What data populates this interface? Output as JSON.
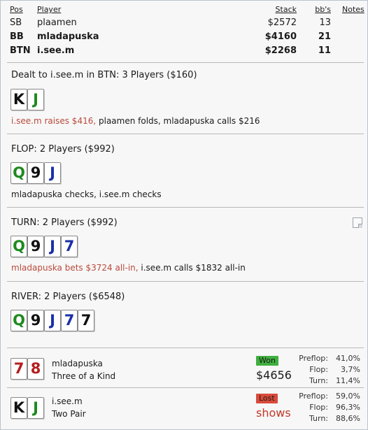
{
  "players_header": {
    "pos": "Pos",
    "player": "Player",
    "stack": "Stack",
    "bbs": "bb's",
    "notes": "Notes"
  },
  "players": [
    {
      "pos": "SB",
      "name": "plaamen",
      "stack": "$2572",
      "bbs": "13"
    },
    {
      "pos": "BB",
      "name": "mladapuska",
      "stack": "$4160",
      "bbs": "21"
    },
    {
      "pos": "BTN",
      "name": "i.see.m",
      "stack": "$2268",
      "bbs": "11"
    }
  ],
  "preflop": {
    "title": "Dealt to i.see.m in BTN: 3 Players ($160)",
    "cards": [
      {
        "rank": "K",
        "suit": "spade"
      },
      {
        "rank": "J",
        "suit": "club"
      }
    ],
    "action_red": "i.see.m raises $416,",
    "action_rest": " plaamen folds, mladapuska calls $216"
  },
  "flop": {
    "title": "FLOP: 2 Players ($992)",
    "cards": [
      {
        "rank": "Q",
        "suit": "club"
      },
      {
        "rank": "9",
        "suit": "spade"
      },
      {
        "rank": "J",
        "suit": "diam"
      }
    ],
    "action": "mladapuska checks, i.see.m checks"
  },
  "turn": {
    "title": "TURN: 2 Players ($992)",
    "cards": [
      {
        "rank": "Q",
        "suit": "club"
      },
      {
        "rank": "9",
        "suit": "spade"
      },
      {
        "rank": "J",
        "suit": "diam"
      },
      {
        "rank": "7",
        "suit": "diam"
      }
    ],
    "action_red": "mladapuska bets $3724 all-in,",
    "action_rest": " i.see.m calls $1832 all-in"
  },
  "river": {
    "title": "RIVER: 2 Players ($6548)",
    "cards": [
      {
        "rank": "Q",
        "suit": "club"
      },
      {
        "rank": "9",
        "suit": "spade"
      },
      {
        "rank": "J",
        "suit": "diam"
      },
      {
        "rank": "7",
        "suit": "diam"
      },
      {
        "rank": "7",
        "suit": "spade"
      }
    ]
  },
  "showdown": [
    {
      "name": "mladapuska",
      "hand": "Three of a Kind",
      "cards": [
        {
          "rank": "7",
          "suit": "heart"
        },
        {
          "rank": "8",
          "suit": "heart"
        }
      ],
      "result": "Won",
      "amount": "$4656",
      "stats": [
        {
          "label": "Preflop:",
          "value": "41,0%"
        },
        {
          "label": "Flop:",
          "value": "3,7%"
        },
        {
          "label": "Turn:",
          "value": "11,4%"
        }
      ]
    },
    {
      "name": "i.see.m",
      "hand": "Two Pair",
      "cards": [
        {
          "rank": "K",
          "suit": "spade"
        },
        {
          "rank": "J",
          "suit": "club"
        }
      ],
      "result": "Lost",
      "amount": "shows",
      "stats": [
        {
          "label": "Preflop:",
          "value": "59,0%"
        },
        {
          "label": "Flop:",
          "value": "96,3%"
        },
        {
          "label": "Turn:",
          "value": "88,6%"
        }
      ]
    }
  ],
  "colors": {
    "action_red": "#b94a3b",
    "won_badge": "#3faf3f",
    "lost_badge": "#d94a3a",
    "club": "#1e8a1e",
    "diam": "#1a2fa8",
    "spade": "#111111",
    "heart": "#b41e1e"
  }
}
